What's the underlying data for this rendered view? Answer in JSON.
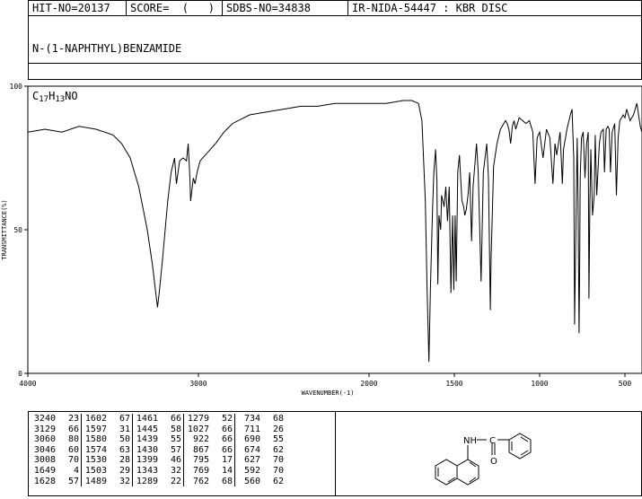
{
  "header": {
    "hit_no": "HIT-NO=20137",
    "score": "SCORE=  (   )",
    "sdbs_no": "SDBS-NO=34838",
    "ir_info": "IR-NIDA-54447 : KBR DISC"
  },
  "compound": {
    "name": "N-(1-NAPHTHYL)BENZAMIDE",
    "formula_parts": [
      "C",
      "17",
      "H",
      "13",
      "NO"
    ]
  },
  "chart_data": {
    "type": "line",
    "xlabel": "WAVENUMBER(-1)",
    "ylabel": "TRANSMITTANCE(%)",
    "xlim": [
      4000,
      400
    ],
    "ylim": [
      0,
      100
    ],
    "xticks": [
      4000,
      3000,
      2000,
      1500,
      1000,
      500
    ],
    "xtick_labels": [
      "4000",
      "3000",
      "2000",
      "1500",
      "1000",
      "500"
    ],
    "yticks": [
      0,
      50,
      100
    ],
    "ytick_labels": [
      "0",
      "50",
      "100"
    ],
    "grid": false,
    "x": [
      4000,
      3900,
      3800,
      3700,
      3600,
      3500,
      3450,
      3400,
      3350,
      3300,
      3270,
      3250,
      3240,
      3230,
      3210,
      3180,
      3160,
      3140,
      3129,
      3110,
      3090,
      3070,
      3060,
      3050,
      3046,
      3030,
      3020,
      3008,
      2990,
      2960,
      2930,
      2900,
      2850,
      2800,
      2700,
      2600,
      2500,
      2400,
      2300,
      2200,
      2100,
      2000,
      1900,
      1800,
      1750,
      1710,
      1690,
      1670,
      1660,
      1649,
      1640,
      1628,
      1620,
      1610,
      1602,
      1597,
      1590,
      1580,
      1575,
      1560,
      1550,
      1540,
      1530,
      1520,
      1510,
      1503,
      1495,
      1489,
      1480,
      1470,
      1461,
      1455,
      1445,
      1439,
      1430,
      1420,
      1410,
      1399,
      1390,
      1370,
      1360,
      1343,
      1330,
      1310,
      1300,
      1289,
      1285,
      1279,
      1270,
      1250,
      1230,
      1210,
      1200,
      1190,
      1180,
      1170,
      1160,
      1150,
      1140,
      1120,
      1100,
      1080,
      1060,
      1040,
      1027,
      1015,
      1000,
      980,
      960,
      940,
      922,
      910,
      900,
      880,
      867,
      860,
      840,
      820,
      810,
      800,
      795,
      790,
      780,
      775,
      769,
      765,
      762,
      755,
      745,
      734,
      725,
      715,
      711,
      705,
      700,
      690,
      680,
      674,
      665,
      650,
      640,
      627,
      620,
      610,
      600,
      592,
      585,
      575,
      560,
      550,
      540,
      530,
      520,
      510,
      500,
      490,
      480,
      470,
      460,
      450,
      440,
      430,
      420,
      410,
      400
    ],
    "y": [
      84,
      85,
      84,
      86,
      85,
      83,
      80,
      75,
      65,
      50,
      38,
      28,
      23,
      28,
      40,
      60,
      70,
      75,
      66,
      74,
      75,
      74,
      80,
      68,
      60,
      68,
      66,
      70,
      74,
      76,
      78,
      80,
      84,
      87,
      90,
      91,
      92,
      93,
      93,
      94,
      94,
      94,
      94,
      95,
      95,
      94,
      88,
      60,
      30,
      4,
      30,
      57,
      70,
      78,
      67,
      31,
      55,
      50,
      62,
      58,
      65,
      53,
      65,
      28,
      55,
      29,
      55,
      32,
      70,
      76,
      66,
      60,
      58,
      55,
      57,
      62,
      70,
      46,
      65,
      80,
      70,
      32,
      70,
      80,
      68,
      22,
      40,
      52,
      72,
      80,
      85,
      87,
      88,
      87,
      85,
      80,
      86,
      88,
      85,
      89,
      88,
      87,
      88,
      84,
      66,
      82,
      84,
      75,
      85,
      82,
      66,
      80,
      76,
      84,
      66,
      78,
      85,
      90,
      92,
      75,
      17,
      40,
      82,
      60,
      14,
      38,
      68,
      82,
      84,
      68,
      80,
      84,
      26,
      60,
      78,
      55,
      62,
      83,
      62,
      80,
      84,
      85,
      70,
      85,
      86,
      85,
      70,
      84,
      87,
      62,
      82,
      88,
      89,
      90,
      89,
      92,
      90,
      88,
      89,
      90,
      92,
      94,
      90,
      86,
      84,
      82
    ],
    "peaks": [
      {
        "wavenumber": 3240,
        "transmittance": 23
      },
      {
        "wavenumber": 3129,
        "transmittance": 66
      },
      {
        "wavenumber": 3060,
        "transmittance": 80
      },
      {
        "wavenumber": 3046,
        "transmittance": 60
      },
      {
        "wavenumber": 3008,
        "transmittance": 70
      },
      {
        "wavenumber": 1649,
        "transmittance": 4
      },
      {
        "wavenumber": 1628,
        "transmittance": 57
      },
      {
        "wavenumber": 1602,
        "transmittance": 67
      },
      {
        "wavenumber": 1597,
        "transmittance": 31
      },
      {
        "wavenumber": 1580,
        "transmittance": 50
      },
      {
        "wavenumber": 1574,
        "transmittance": 63
      },
      {
        "wavenumber": 1530,
        "transmittance": 28
      },
      {
        "wavenumber": 1503,
        "transmittance": 29
      },
      {
        "wavenumber": 1489,
        "transmittance": 32
      },
      {
        "wavenumber": 1461,
        "transmittance": 66
      },
      {
        "wavenumber": 1445,
        "transmittance": 58
      },
      {
        "wavenumber": 1439,
        "transmittance": 55
      },
      {
        "wavenumber": 1430,
        "transmittance": 57
      },
      {
        "wavenumber": 1399,
        "transmittance": 46
      },
      {
        "wavenumber": 1343,
        "transmittance": 32
      },
      {
        "wavenumber": 1289,
        "transmittance": 22
      },
      {
        "wavenumber": 1279,
        "transmittance": 52
      },
      {
        "wavenumber": 1027,
        "transmittance": 66
      },
      {
        "wavenumber": 922,
        "transmittance": 66
      },
      {
        "wavenumber": 867,
        "transmittance": 66
      },
      {
        "wavenumber": 795,
        "transmittance": 17
      },
      {
        "wavenumber": 769,
        "transmittance": 14
      },
      {
        "wavenumber": 762,
        "transmittance": 68
      },
      {
        "wavenumber": 734,
        "transmittance": 68
      },
      {
        "wavenumber": 711,
        "transmittance": 26
      },
      {
        "wavenumber": 690,
        "transmittance": 55
      },
      {
        "wavenumber": 674,
        "transmittance": 62
      },
      {
        "wavenumber": 627,
        "transmittance": 70
      },
      {
        "wavenumber": 592,
        "transmittance": 70
      },
      {
        "wavenumber": 560,
        "transmittance": 62
      }
    ]
  },
  "peak_table": {
    "columns": [
      [
        [
          "3240",
          "23"
        ],
        [
          "3129",
          "66"
        ],
        [
          "3060",
          "80"
        ],
        [
          "3046",
          "60"
        ],
        [
          "3008",
          "70"
        ],
        [
          "1649",
          "4"
        ],
        [
          "1628",
          "57"
        ]
      ],
      [
        [
          "1602",
          "67"
        ],
        [
          "1597",
          "31"
        ],
        [
          "1580",
          "50"
        ],
        [
          "1574",
          "63"
        ],
        [
          "1530",
          "28"
        ],
        [
          "1503",
          "29"
        ],
        [
          "1489",
          "32"
        ]
      ],
      [
        [
          "1461",
          "66"
        ],
        [
          "1445",
          "58"
        ],
        [
          "1439",
          "55"
        ],
        [
          "1430",
          "57"
        ],
        [
          "1399",
          "46"
        ],
        [
          "1343",
          "32"
        ],
        [
          "1289",
          "22"
        ]
      ],
      [
        [
          "1279",
          "52"
        ],
        [
          "1027",
          "66"
        ],
        [
          "922",
          "66"
        ],
        [
          "867",
          "66"
        ],
        [
          "795",
          "17"
        ],
        [
          "769",
          "14"
        ],
        [
          "762",
          "68"
        ]
      ],
      [
        [
          "734",
          "68"
        ],
        [
          "711",
          "26"
        ],
        [
          "690",
          "55"
        ],
        [
          "674",
          "62"
        ],
        [
          "627",
          "70"
        ],
        [
          "592",
          "70"
        ],
        [
          "560",
          "62"
        ]
      ]
    ]
  },
  "structure": {
    "nh_label": "NH",
    "c_label": "C",
    "o_label": "O"
  }
}
